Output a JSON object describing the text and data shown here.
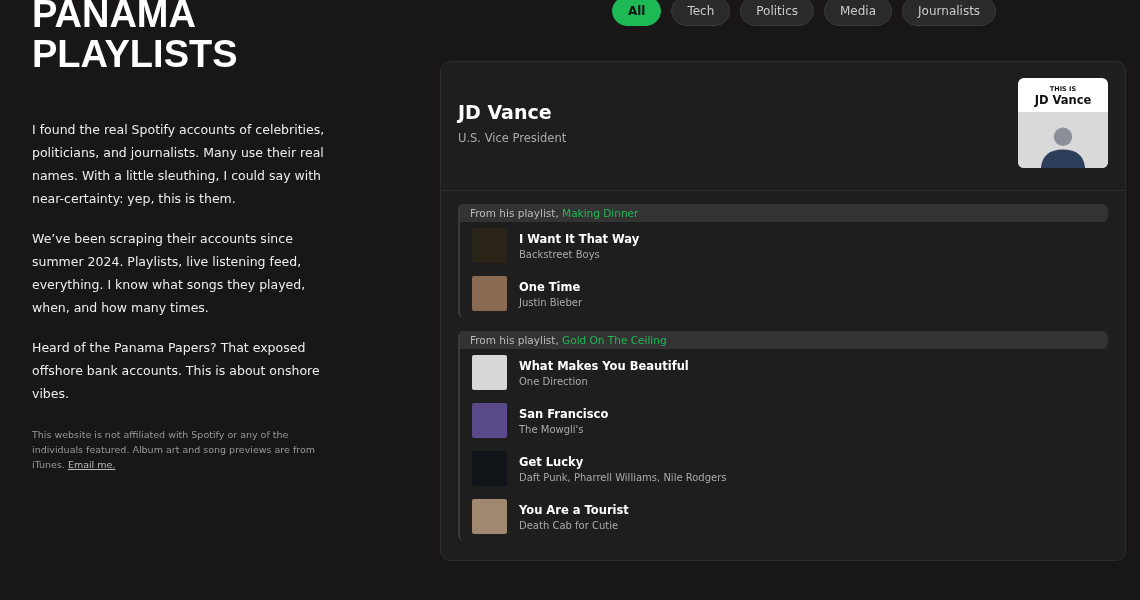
{
  "site": {
    "title_lines": [
      "PANAMA",
      "PLAYLISTS"
    ],
    "paragraphs": [
      "I found the real Spotify accounts of celebrities, politicians, and journalists. Many use their real names. With a little sleuthing, I could say with near-certainty: yep, this is them.",
      "We’ve been scraping their accounts since summer 2024. Playlists, live listening feed, everything. I know what songs they played, when, and how many times.",
      "Heard of the Panama Papers? That exposed offshore bank accounts. This is about onshore vibes."
    ],
    "disclaimer": "This website is not affiliated with Spotify or any of the individuals featured. Album art and song previews are from iTunes.",
    "email_link": "Email me."
  },
  "filters": [
    {
      "label": "All",
      "selected": true
    },
    {
      "label": "Tech",
      "selected": false
    },
    {
      "label": "Politics",
      "selected": false
    },
    {
      "label": "Media",
      "selected": false
    },
    {
      "label": "Journalists",
      "selected": false
    }
  ],
  "profile": {
    "name": "JD Vance",
    "role": "U.S. Vice President",
    "cover": {
      "kicker": "THIS IS",
      "name": "JD Vance"
    }
  },
  "playlists": [
    {
      "prefix": "From his playlist,",
      "name": "Making Dinner",
      "tracks": [
        {
          "title": "I Want It That Way",
          "artist": "Backstreet Boys",
          "color": "#2a2418"
        },
        {
          "title": "One Time",
          "artist": "Justin Bieber",
          "color": "#8a6a50"
        }
      ]
    },
    {
      "prefix": "From his playlist,",
      "name": "Gold On The Ceiling",
      "tracks": [
        {
          "title": "What Makes You Beautiful",
          "artist": "One Direction",
          "color": "#d8d8d8"
        },
        {
          "title": "San Francisco",
          "artist": "The Mowgli's",
          "color": "#5a4a8a"
        },
        {
          "title": "Get Lucky",
          "artist": "Daft Punk, Pharrell Williams, Nile Rodgers",
          "color": "#101418"
        },
        {
          "title": "You Are a Tourist",
          "artist": "Death Cab for Cutie",
          "color": "#a08870"
        }
      ]
    }
  ]
}
